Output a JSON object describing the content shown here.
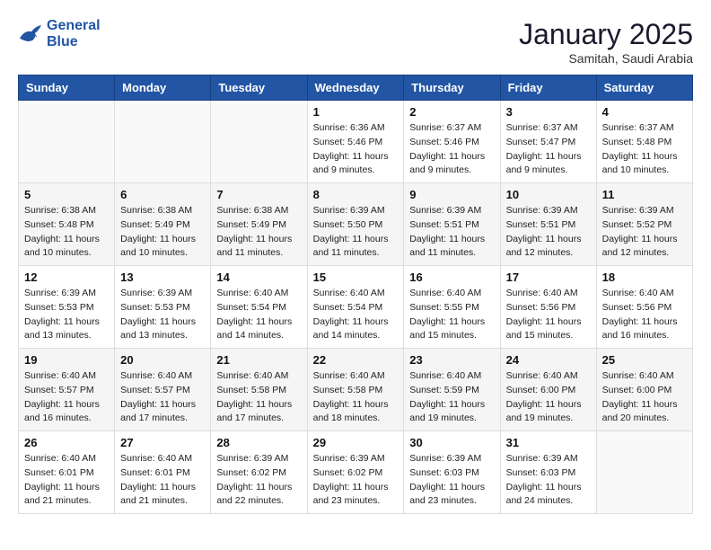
{
  "header": {
    "logo_line1": "General",
    "logo_line2": "Blue",
    "month": "January 2025",
    "location": "Samitah, Saudi Arabia"
  },
  "weekdays": [
    "Sunday",
    "Monday",
    "Tuesday",
    "Wednesday",
    "Thursday",
    "Friday",
    "Saturday"
  ],
  "weeks": [
    [
      {
        "day": "",
        "info": ""
      },
      {
        "day": "",
        "info": ""
      },
      {
        "day": "",
        "info": ""
      },
      {
        "day": "1",
        "info": "Sunrise: 6:36 AM\nSunset: 5:46 PM\nDaylight: 11 hours\nand 9 minutes."
      },
      {
        "day": "2",
        "info": "Sunrise: 6:37 AM\nSunset: 5:46 PM\nDaylight: 11 hours\nand 9 minutes."
      },
      {
        "day": "3",
        "info": "Sunrise: 6:37 AM\nSunset: 5:47 PM\nDaylight: 11 hours\nand 9 minutes."
      },
      {
        "day": "4",
        "info": "Sunrise: 6:37 AM\nSunset: 5:48 PM\nDaylight: 11 hours\nand 10 minutes."
      }
    ],
    [
      {
        "day": "5",
        "info": "Sunrise: 6:38 AM\nSunset: 5:48 PM\nDaylight: 11 hours\nand 10 minutes."
      },
      {
        "day": "6",
        "info": "Sunrise: 6:38 AM\nSunset: 5:49 PM\nDaylight: 11 hours\nand 10 minutes."
      },
      {
        "day": "7",
        "info": "Sunrise: 6:38 AM\nSunset: 5:49 PM\nDaylight: 11 hours\nand 11 minutes."
      },
      {
        "day": "8",
        "info": "Sunrise: 6:39 AM\nSunset: 5:50 PM\nDaylight: 11 hours\nand 11 minutes."
      },
      {
        "day": "9",
        "info": "Sunrise: 6:39 AM\nSunset: 5:51 PM\nDaylight: 11 hours\nand 11 minutes."
      },
      {
        "day": "10",
        "info": "Sunrise: 6:39 AM\nSunset: 5:51 PM\nDaylight: 11 hours\nand 12 minutes."
      },
      {
        "day": "11",
        "info": "Sunrise: 6:39 AM\nSunset: 5:52 PM\nDaylight: 11 hours\nand 12 minutes."
      }
    ],
    [
      {
        "day": "12",
        "info": "Sunrise: 6:39 AM\nSunset: 5:53 PM\nDaylight: 11 hours\nand 13 minutes."
      },
      {
        "day": "13",
        "info": "Sunrise: 6:39 AM\nSunset: 5:53 PM\nDaylight: 11 hours\nand 13 minutes."
      },
      {
        "day": "14",
        "info": "Sunrise: 6:40 AM\nSunset: 5:54 PM\nDaylight: 11 hours\nand 14 minutes."
      },
      {
        "day": "15",
        "info": "Sunrise: 6:40 AM\nSunset: 5:54 PM\nDaylight: 11 hours\nand 14 minutes."
      },
      {
        "day": "16",
        "info": "Sunrise: 6:40 AM\nSunset: 5:55 PM\nDaylight: 11 hours\nand 15 minutes."
      },
      {
        "day": "17",
        "info": "Sunrise: 6:40 AM\nSunset: 5:56 PM\nDaylight: 11 hours\nand 15 minutes."
      },
      {
        "day": "18",
        "info": "Sunrise: 6:40 AM\nSunset: 5:56 PM\nDaylight: 11 hours\nand 16 minutes."
      }
    ],
    [
      {
        "day": "19",
        "info": "Sunrise: 6:40 AM\nSunset: 5:57 PM\nDaylight: 11 hours\nand 16 minutes."
      },
      {
        "day": "20",
        "info": "Sunrise: 6:40 AM\nSunset: 5:57 PM\nDaylight: 11 hours\nand 17 minutes."
      },
      {
        "day": "21",
        "info": "Sunrise: 6:40 AM\nSunset: 5:58 PM\nDaylight: 11 hours\nand 17 minutes."
      },
      {
        "day": "22",
        "info": "Sunrise: 6:40 AM\nSunset: 5:58 PM\nDaylight: 11 hours\nand 18 minutes."
      },
      {
        "day": "23",
        "info": "Sunrise: 6:40 AM\nSunset: 5:59 PM\nDaylight: 11 hours\nand 19 minutes."
      },
      {
        "day": "24",
        "info": "Sunrise: 6:40 AM\nSunset: 6:00 PM\nDaylight: 11 hours\nand 19 minutes."
      },
      {
        "day": "25",
        "info": "Sunrise: 6:40 AM\nSunset: 6:00 PM\nDaylight: 11 hours\nand 20 minutes."
      }
    ],
    [
      {
        "day": "26",
        "info": "Sunrise: 6:40 AM\nSunset: 6:01 PM\nDaylight: 11 hours\nand 21 minutes."
      },
      {
        "day": "27",
        "info": "Sunrise: 6:40 AM\nSunset: 6:01 PM\nDaylight: 11 hours\nand 21 minutes."
      },
      {
        "day": "28",
        "info": "Sunrise: 6:39 AM\nSunset: 6:02 PM\nDaylight: 11 hours\nand 22 minutes."
      },
      {
        "day": "29",
        "info": "Sunrise: 6:39 AM\nSunset: 6:02 PM\nDaylight: 11 hours\nand 23 minutes."
      },
      {
        "day": "30",
        "info": "Sunrise: 6:39 AM\nSunset: 6:03 PM\nDaylight: 11 hours\nand 23 minutes."
      },
      {
        "day": "31",
        "info": "Sunrise: 6:39 AM\nSunset: 6:03 PM\nDaylight: 11 hours\nand 24 minutes."
      },
      {
        "day": "",
        "info": ""
      }
    ]
  ]
}
